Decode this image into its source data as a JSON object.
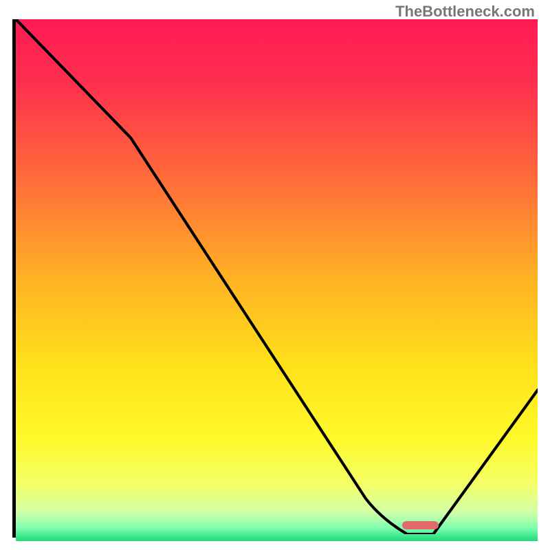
{
  "watermark": "TheBottleneck.com",
  "chart_data": {
    "type": "line",
    "title": "",
    "xlabel": "",
    "ylabel": "",
    "xlim": [
      0,
      100
    ],
    "ylim": [
      0,
      100
    ],
    "series": [
      {
        "name": "curve",
        "x": [
          0,
          22,
          70,
          75,
          80,
          100
        ],
        "y": [
          100,
          77,
          3,
          0,
          0,
          28
        ]
      }
    ],
    "marker": {
      "x_start": 74,
      "x_end": 81,
      "y": 1.5
    },
    "gradient_stops": [
      {
        "pos": 0.0,
        "color": "#ff1a56"
      },
      {
        "pos": 0.12,
        "color": "#ff2f4e"
      },
      {
        "pos": 0.3,
        "color": "#ff6a3a"
      },
      {
        "pos": 0.5,
        "color": "#ffb324"
      },
      {
        "pos": 0.66,
        "color": "#ffe01a"
      },
      {
        "pos": 0.8,
        "color": "#fff92a"
      },
      {
        "pos": 0.89,
        "color": "#f3ff66"
      },
      {
        "pos": 0.945,
        "color": "#d2ffa8"
      },
      {
        "pos": 0.975,
        "color": "#7fffb0"
      },
      {
        "pos": 1.0,
        "color": "#1bd978"
      }
    ]
  }
}
